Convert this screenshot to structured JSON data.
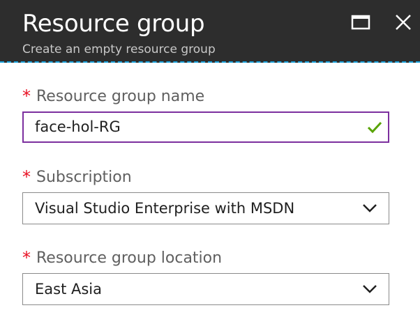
{
  "blade": {
    "title": "Resource group",
    "subtitle": "Create an empty resource group",
    "icons": {
      "maximize": "maximize-icon",
      "close": "close-icon"
    }
  },
  "form": {
    "required_marker": "*",
    "resource_group_name": {
      "label": "Resource group name",
      "value": "face-hol-RG",
      "status_icon": "checkmark-icon",
      "valid": true
    },
    "subscription": {
      "label": "Subscription",
      "selected": "Visual Studio Enterprise with MSDN"
    },
    "location": {
      "label": "Resource group location",
      "selected": "East Asia"
    }
  },
  "colors": {
    "header_bg": "#2d2d2d",
    "header_accent": "#1aa3dd",
    "required": "#e81123",
    "focus_border": "#7c2f9e",
    "valid": "#57a300"
  }
}
